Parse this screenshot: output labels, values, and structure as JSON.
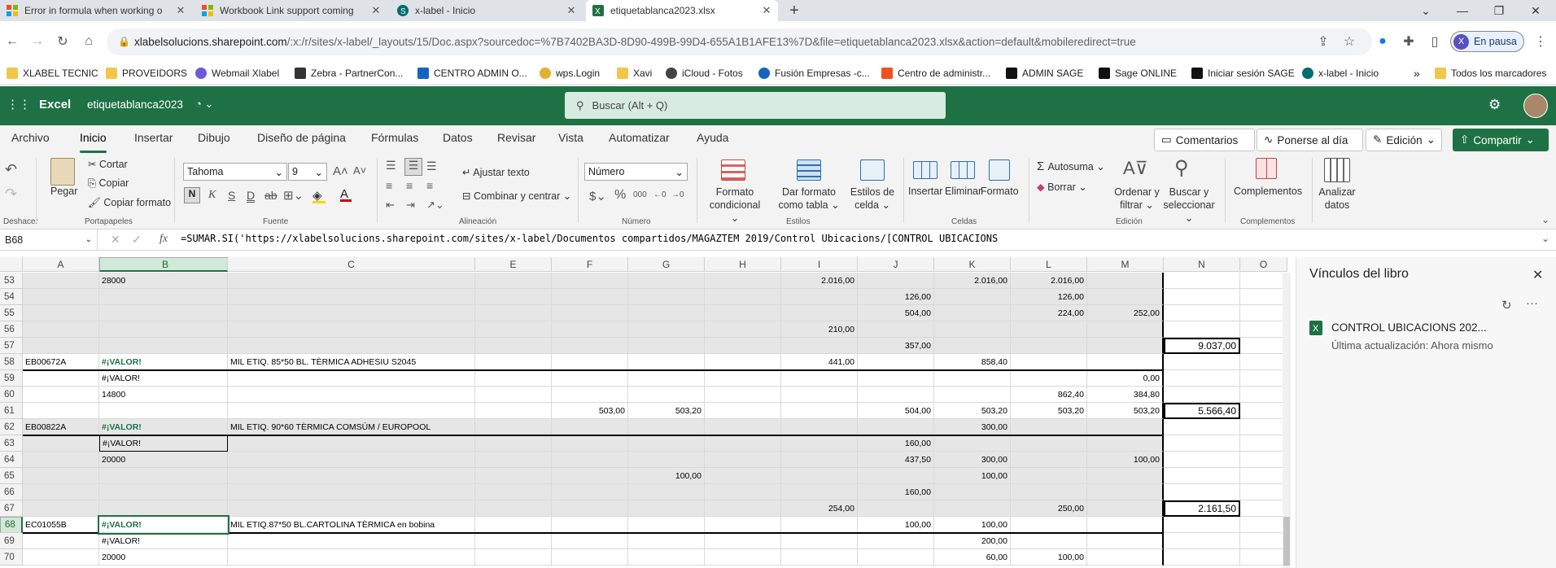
{
  "browser": {
    "tabs": [
      {
        "title": "Error in formula when working o",
        "icon": "microsoft-icon",
        "color": "#f25022"
      },
      {
        "title": "Workbook Link support coming",
        "icon": "microsoft-icon",
        "color": "#f25022"
      },
      {
        "title": "x-label - Inicio",
        "icon": "sharepoint-icon",
        "color": "#036c70"
      },
      {
        "title": "etiquetablanca2023.xlsx",
        "icon": "excel-icon",
        "color": "#1e7145"
      }
    ],
    "new_tab": "+",
    "url_host": "xlabelsolucions.sharepoint.com",
    "url_rest": "/:x:/r/sites/x-label/_layouts/15/Doc.aspx?sourcedoc=%7B7402BA3D-8D90-499B-99D4-655A1B1AFE13%7D&file=etiquetablanca2023.xlsx&action=default&mobileredirect=true",
    "profile_initial": "X",
    "profile_label": "En pausa",
    "bookmarks": [
      {
        "label": "XLABEL TECNIC",
        "color": "#f3c64a"
      },
      {
        "label": "PROVEIDORS",
        "color": "#f3c64a"
      },
      {
        "label": "Webmail Xlabel",
        "color": "#6b5bd6"
      },
      {
        "label": "Zebra - PartnerCon...",
        "color": "#333333"
      },
      {
        "label": "CENTRO ADMIN O...",
        "color": "#1565c0"
      },
      {
        "label": "wps.Login",
        "color": "#e0b030"
      },
      {
        "label": "Xavi",
        "color": "#f3c64a"
      },
      {
        "label": "iCloud - Fotos",
        "color": "#444444"
      },
      {
        "label": "Fusión Empresas -c...",
        "color": "#1565c0"
      },
      {
        "label": "Centro de administr...",
        "color": "#f25022"
      },
      {
        "label": "ADMIN SAGE",
        "color": "#111111"
      },
      {
        "label": "Sage ONLINE",
        "color": "#111111"
      },
      {
        "label": "Iniciar sesión SAGE",
        "color": "#111111"
      },
      {
        "label": "x-label - Inicio",
        "color": "#036c70"
      }
    ],
    "bookmarks_more": "»",
    "bookmarks_all": "Todos los marcadores"
  },
  "excel": {
    "app_name": "Excel",
    "file_name": "etiquetablanca2023",
    "search_placeholder": "Buscar (Alt + Q)",
    "menu_tabs": [
      "Archivo",
      "Inicio",
      "Insertar",
      "Dibujo",
      "Diseño de página",
      "Fórmulas",
      "Datos",
      "Revisar",
      "Vista",
      "Automatizar",
      "Ayuda"
    ],
    "header_buttons": {
      "comments": "Comentarios",
      "catchup": "Ponerse al día",
      "editing": "Edición",
      "share": "Compartir"
    },
    "ribbon": {
      "paste": "Pegar",
      "cut": "Cortar",
      "copy": "Copiar",
      "format_painter": "Copiar formato",
      "font_name": "Tahoma",
      "font_size": "9",
      "wrap_text": "Ajustar texto",
      "merge_center": "Combinar y centrar",
      "number_format": "Número",
      "conditional_format": "Formato condicional",
      "format_as_table": "Dar formato como tabla",
      "cell_styles": "Estilos de celda",
      "insert": "Insertar",
      "delete": "Eliminar",
      "format": "Formato",
      "autosum": "Autosuma",
      "clear": "Borrar",
      "sort_filter": "Ordenar y filtrar",
      "find_select": "Buscar y seleccionar",
      "addins": "Complementos",
      "analyze": "Analizar datos",
      "groups": {
        "undo": "Deshacer",
        "clipboard": "Portapapeles",
        "font": "Fuente",
        "alignment": "Alineación",
        "number": "Número",
        "styles": "Estilos",
        "cells": "Celdas",
        "editing": "Edición",
        "addins": "Complementos"
      }
    },
    "name_box": "B68",
    "formula": "=SUMAR.SI('https://xlabelsolucions.sharepoint.com/sites/x-label/Documentos compartidos/MAGAZTEM 2019/Control Ubicacions/[CONTROL UBICACIONS",
    "columns": [
      "A",
      "B",
      "C",
      "E",
      "F",
      "G",
      "H",
      "I",
      "J",
      "K",
      "L",
      "M",
      "N",
      "O"
    ],
    "rows": [
      {
        "n": "53",
        "A": "",
        "B": "28000",
        "C": "",
        "I": "2.016,00",
        "K": "2.016,00",
        "L": "2.016,00"
      },
      {
        "n": "54",
        "J": "126,00",
        "L": "126,00"
      },
      {
        "n": "55",
        "J": "504,00",
        "L": "224,00",
        "M": "252,00"
      },
      {
        "n": "56",
        "I": "210,00"
      },
      {
        "n": "57",
        "J": "357,00",
        "N": "9.037,00"
      },
      {
        "n": "58",
        "A": "EB00672A",
        "B": "#¡VALOR!",
        "C": "MIL ETIQ. 85*50 BL. TÈRMICA ADHESIU S2045",
        "I": "441,00",
        "K": "858,40"
      },
      {
        "n": "59",
        "B": "#¡VALOR!",
        "M": "0,00"
      },
      {
        "n": "60",
        "B": "14800",
        "L": "862,40",
        "M": "384,80"
      },
      {
        "n": "61",
        "F": "503,00",
        "G": "503,20",
        "J": "504,00",
        "K": "503,20",
        "L": "503,20",
        "M": "503,20",
        "N": "5.566,40"
      },
      {
        "n": "62",
        "A": "EB00822A",
        "B": "#¡VALOR!",
        "C": "MIL ETIQ. 90*60 TÈRMICA COMSÚM / EUROPOOL",
        "K": "300,00"
      },
      {
        "n": "63",
        "B": "#¡VALOR!",
        "J": "160,00"
      },
      {
        "n": "64",
        "B": "20000",
        "J": "437,50",
        "K": "300,00",
        "M": "100,00"
      },
      {
        "n": "65",
        "G": "100,00",
        "K": "100,00"
      },
      {
        "n": "66",
        "J": "160,00"
      },
      {
        "n": "67",
        "I": "254,00",
        "L": "250,00",
        "N": "2.161,50"
      },
      {
        "n": "68",
        "A": "EC01055B",
        "B": "#¡VALOR!",
        "C": "MIL ETIQ.87*50 BL.CARTOLINA TÈRMICA en bobina",
        "J": "100,00",
        "K": "100,00"
      },
      {
        "n": "69",
        "B": "#¡VALOR!",
        "K": "200,00"
      },
      {
        "n": "70",
        "B": "20000",
        "K": "60,00",
        "L": "100,00"
      }
    ],
    "side_panel": {
      "title": "Vínculos del libro",
      "link_name": "CONTROL UBICACIONS 202...",
      "link_status": "Última actualización: Ahora mismo"
    }
  }
}
